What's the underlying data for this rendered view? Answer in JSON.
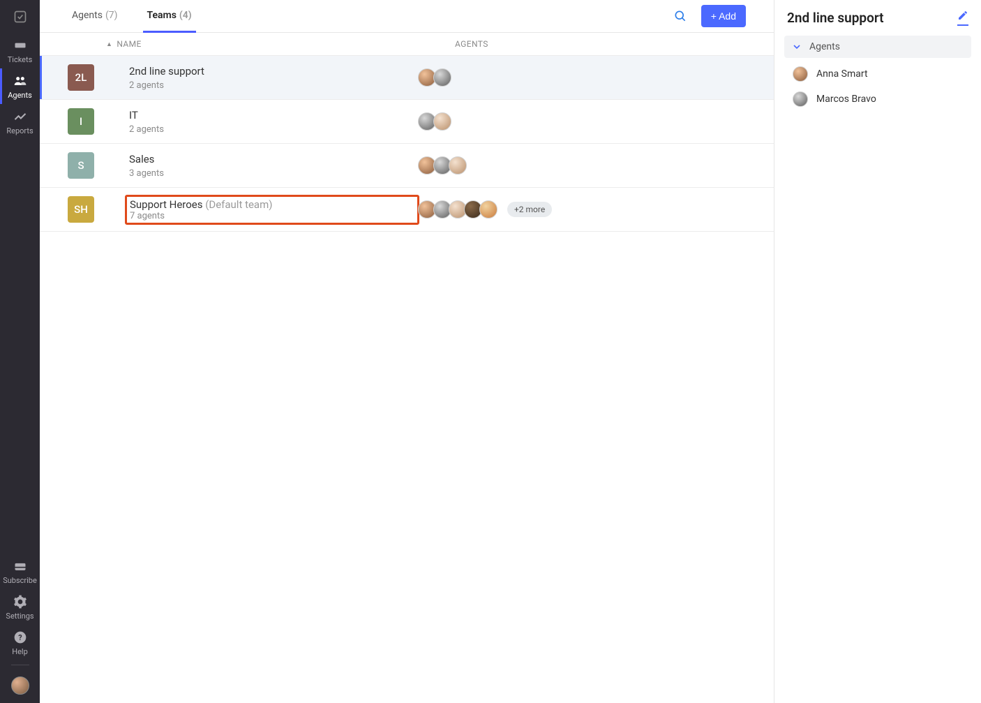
{
  "nav": {
    "items": [
      {
        "id": "tickets",
        "label": "Tickets"
      },
      {
        "id": "agents",
        "label": "Agents"
      },
      {
        "id": "reports",
        "label": "Reports"
      }
    ],
    "bottom": [
      {
        "id": "subscribe",
        "label": "Subscribe"
      },
      {
        "id": "settings",
        "label": "Settings"
      },
      {
        "id": "help",
        "label": "Help"
      }
    ]
  },
  "tabs": {
    "agents": {
      "label": "Agents",
      "count": "(7)"
    },
    "teams": {
      "label": "Teams",
      "count": "(4)"
    }
  },
  "actions": {
    "add_label": "+ Add"
  },
  "table": {
    "col_name": "NAME",
    "col_agents": "AGENTS"
  },
  "teams": [
    {
      "badge": "2L",
      "badge_color": "#8a5a50",
      "name": "2nd line support",
      "suffix": "",
      "sub": "2 agents",
      "avatars": [
        "f1",
        "m1"
      ],
      "more": "",
      "selected": true,
      "highlight": false
    },
    {
      "badge": "I",
      "badge_color": "#6a8f5f",
      "name": "IT",
      "suffix": "",
      "sub": "2 agents",
      "avatars": [
        "m1",
        "m2"
      ],
      "more": "",
      "selected": false,
      "highlight": false
    },
    {
      "badge": "S",
      "badge_color": "#8fb0aa",
      "name": "Sales",
      "suffix": "",
      "sub": "3 agents",
      "avatars": [
        "f1",
        "m1",
        "m2"
      ],
      "more": "",
      "selected": false,
      "highlight": false
    },
    {
      "badge": "SH",
      "badge_color": "#c9a93f",
      "name": "Support Heroes",
      "suffix": " (Default team)",
      "sub": "7 agents",
      "avatars": [
        "f1",
        "m1",
        "m2",
        "d1",
        "b1"
      ],
      "more": "+2 more",
      "selected": false,
      "highlight": true
    }
  ],
  "panel": {
    "title": "2nd line support",
    "section_label": "Agents",
    "agents": [
      {
        "name": "Anna Smart",
        "cls": "f1"
      },
      {
        "name": "Marcos Bravo",
        "cls": "m1"
      }
    ]
  }
}
